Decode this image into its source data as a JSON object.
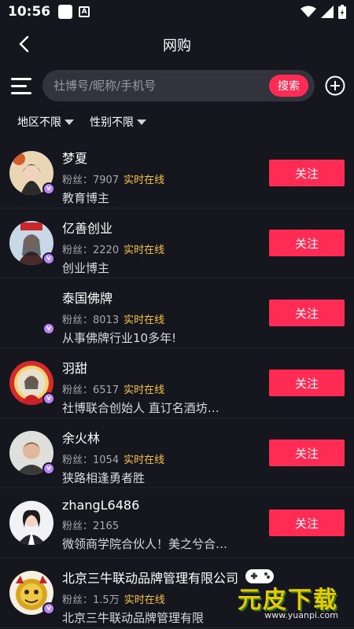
{
  "status_bar": {
    "time": "10:56",
    "a_label": "A"
  },
  "header": {
    "title": "网购"
  },
  "search": {
    "placeholder": "社博号/昵称/手机号",
    "button_label": "搜索"
  },
  "filters": [
    {
      "label": "地区不限"
    },
    {
      "label": "性别不限"
    }
  ],
  "users": [
    {
      "name": "梦夏",
      "fans_label": "粉丝：",
      "fans": "7907",
      "online": "实时在线",
      "bio": "教育博主",
      "follow_label": "关注"
    },
    {
      "name": "亿善创业",
      "fans_label": "粉丝：",
      "fans": "2220",
      "online": "实时在线",
      "bio": "创业博主",
      "follow_label": "关注"
    },
    {
      "name": "泰国佛牌",
      "fans_label": "粉丝：",
      "fans": "8013",
      "online": "实时在线",
      "bio": "从事佛牌行业10多年!",
      "follow_label": "关注"
    },
    {
      "name": "羽甜",
      "fans_label": "粉丝：",
      "fans": "6517",
      "online": "实时在线",
      "bio": "社博联合创始人  直订名酒坊…",
      "follow_label": "关注"
    },
    {
      "name": "余火林",
      "fans_label": "粉丝：",
      "fans": "1054",
      "online": "实时在线",
      "bio": "狭路相逢勇者胜",
      "follow_label": "关注"
    },
    {
      "name": "zhangL6486",
      "fans_label": "粉丝：",
      "fans": "2165",
      "online": "",
      "bio": "微领商学院合伙人！美之兮合…",
      "follow_label": "关注"
    },
    {
      "name": "北京三牛联动品牌管理有限公司",
      "fans_label": "粉丝：",
      "fans": "1.5万",
      "online": "实时在线",
      "bio": "北京三牛联动品牌管理有限",
      "follow_label": ""
    }
  ],
  "badge_label": "v",
  "watermark": {
    "text": "元皮下载",
    "url": "www.yuanpi.com"
  },
  "colors": {
    "accent": "#fe2c55",
    "online": "#f6c443",
    "background": "#16161e",
    "badge": "#b786ff"
  }
}
